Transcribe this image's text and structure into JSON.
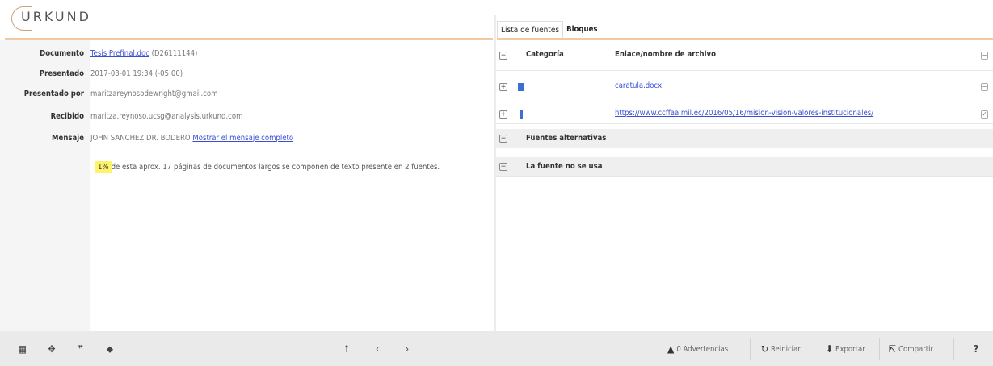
{
  "header": {
    "logo_text": "URKUND"
  },
  "tabs": [
    {
      "label": "Lista de fuentes",
      "active": true
    },
    {
      "label": "Bloques",
      "active": false
    }
  ],
  "document": {
    "labels": {
      "documento": "Documento",
      "presentado": "Presentado",
      "presentado_por": "Presentado por",
      "recibido": "Recibido",
      "mensaje": "Mensaje"
    },
    "documento_link": "Tesis Prefinal.doc",
    "documento_id": "(D26111144)",
    "presentado": "2017-03-01 19:34 (-05:00)",
    "presentado_por": "maritzareynosodewright@gmail.com",
    "recibido": "maritza.reynoso.ucsg@analysis.urkund.com",
    "mensaje": "JOHN SANCHEZ DR. BODERO",
    "mensaje_link": "Mostrar el mensaje completo",
    "percent": "1%",
    "summary": "de esta aprox. 17 páginas de documentos largos se componen de texto presente en 2 fuentes."
  },
  "sources": {
    "col_categoria": "Categoría",
    "col_enlace": "Enlace/nombre de archivo",
    "items": [
      {
        "name": "caratula.docx",
        "icon": "document-icon"
      },
      {
        "name": "https://www.ccffaa.mil.ec/2016/05/16/mision-vision-valores-institucionales/",
        "icon": "info-icon"
      }
    ],
    "alt_sources": "Fuentes alternativas",
    "unused_sources": "La fuente no se usa"
  },
  "toolbar": {
    "warnings": "0 Advertencias",
    "reset": "Reiniciar",
    "export": "Exportar",
    "share": "Compartir"
  },
  "colors": {
    "accent_line": "#f0c9a5",
    "link": "#3a4fd0",
    "highlight": "#fff36b"
  }
}
